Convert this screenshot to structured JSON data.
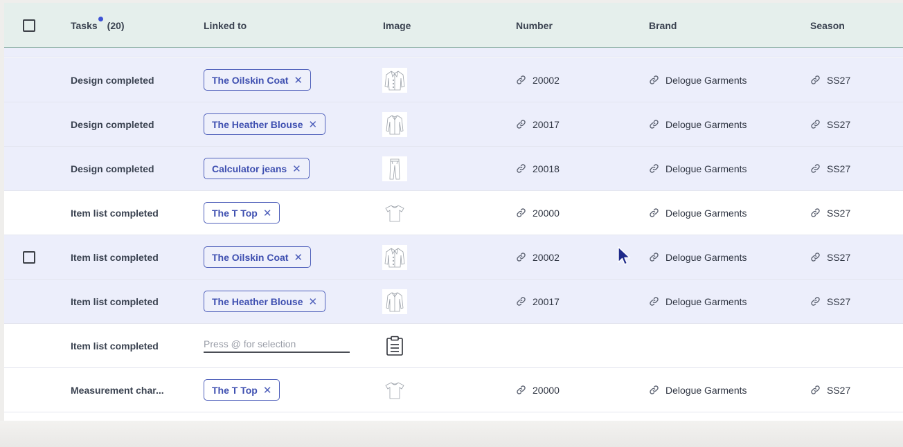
{
  "header": {
    "tasks_label": "Tasks",
    "tasks_count": "(20)",
    "linked_to": "Linked to",
    "image": "Image",
    "number": "Number",
    "brand": "Brand",
    "season": "Season"
  },
  "rows": [
    {
      "task": "Design completed",
      "linked": "The Oilskin Coat",
      "image_icon": "coat-thumbnail-icon",
      "number": "20002",
      "brand": "Delogue Garments",
      "season": "SS27",
      "selected": true
    },
    {
      "task": "Design completed",
      "linked": "The Heather Blouse",
      "image_icon": "blouse-thumbnail-icon",
      "number": "20017",
      "brand": "Delogue Garments",
      "season": "SS27",
      "selected": true
    },
    {
      "task": "Design completed",
      "linked": "Calculator jeans",
      "image_icon": "jeans-thumbnail-icon",
      "number": "20018",
      "brand": "Delogue Garments",
      "season": "SS27",
      "selected": true
    },
    {
      "task": "Item list completed",
      "linked": "The T Top",
      "image_icon": "tshirt-thumbnail-icon",
      "number": "20000",
      "brand": "Delogue Garments",
      "season": "SS27",
      "selected": false
    },
    {
      "task": "Item list completed",
      "linked": "The Oilskin Coat",
      "image_icon": "coat-thumbnail-icon",
      "number": "20002",
      "brand": "Delogue Garments",
      "season": "SS27",
      "selected": true
    },
    {
      "task": "Item list completed",
      "linked": "The Heather Blouse",
      "image_icon": "blouse-thumbnail-icon",
      "number": "20017",
      "brand": "Delogue Garments",
      "season": "SS27",
      "selected": true
    },
    {
      "task": "Item list completed",
      "input_placeholder": "Press @ for selection",
      "image_icon": "clipboard-icon",
      "selected": false
    },
    {
      "task": "Measurement char...",
      "linked": "The T Top",
      "image_icon": "tshirt-thumbnail-icon",
      "number": "20000",
      "brand": "Delogue Garments",
      "season": "SS27",
      "selected": false
    }
  ],
  "colors": {
    "header_bg": "#e5efec",
    "selected_row_bg": "#eceefb",
    "chip_border": "#4e5fba",
    "chip_text": "#3e4fb0",
    "indicator_dot": "#3d52d5"
  },
  "icons": {
    "link": "link-icon",
    "remove": "close-icon",
    "cursor": "mouse-pointer-icon"
  }
}
